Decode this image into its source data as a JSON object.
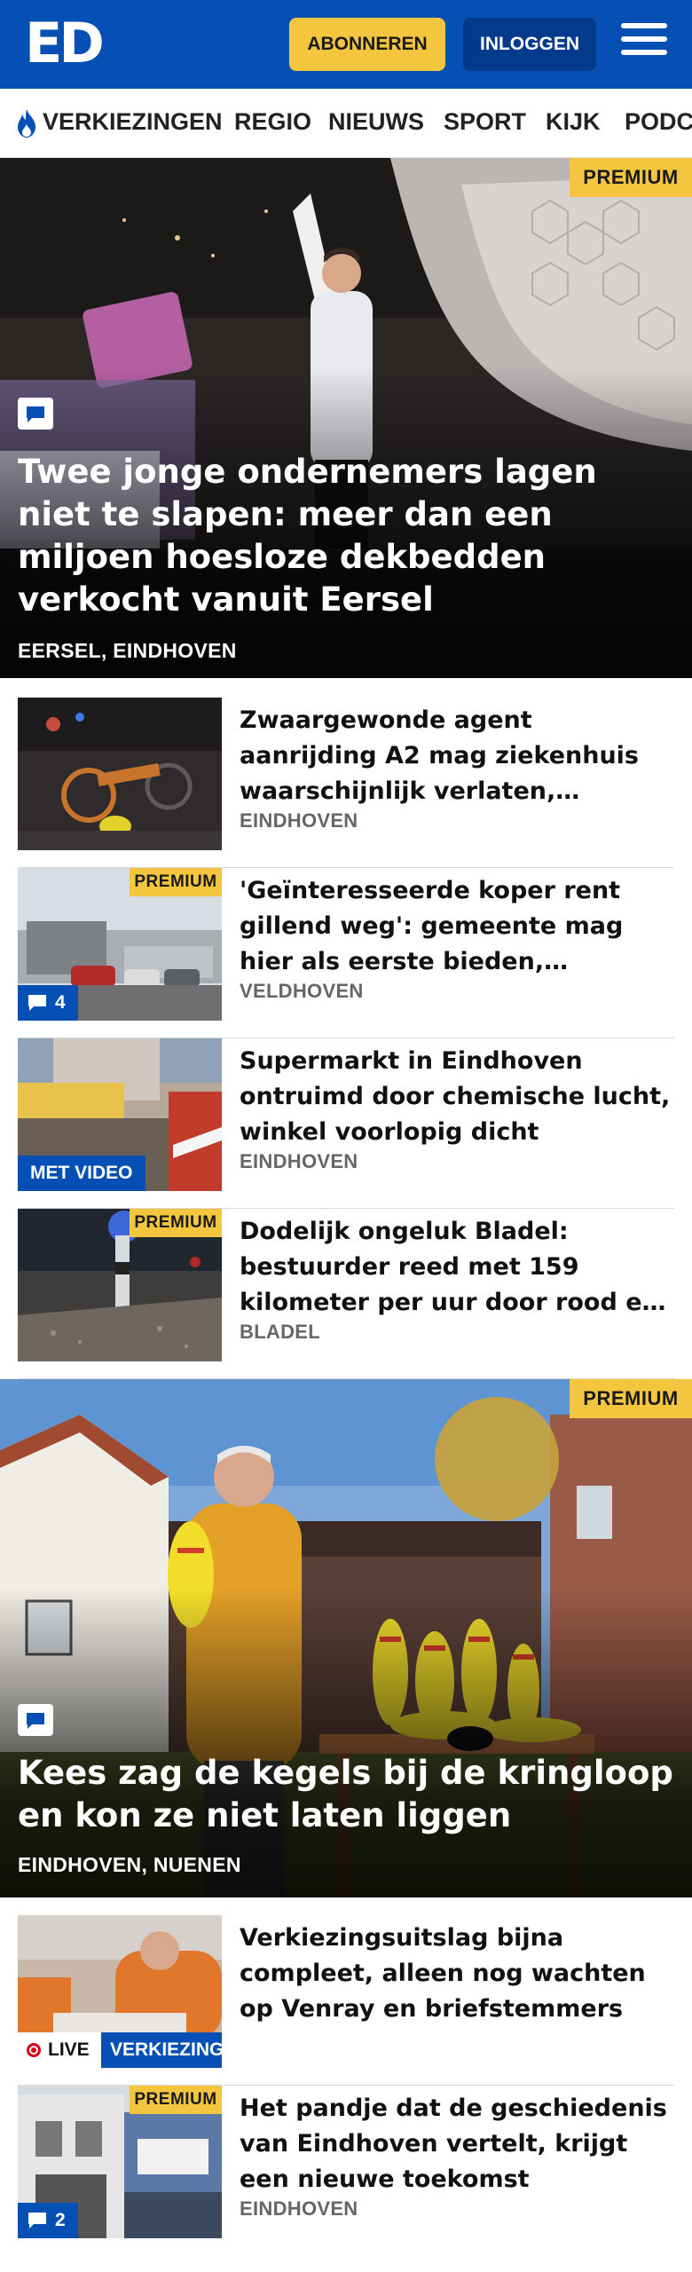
{
  "header": {
    "logo": "ED",
    "subscribe_label": "ABONNEREN",
    "login_label": "INLOGGEN"
  },
  "nav": {
    "items": [
      "VERKIEZINGEN",
      "REGIO",
      "NIEUWS",
      "SPORT",
      "KIJK",
      "PODCAST"
    ]
  },
  "badges": {
    "premium": "PREMIUM",
    "video": "MET VIDEO",
    "live": "LIVE"
  },
  "hero1": {
    "title": "Twee jonge ondernemers lagen niet te slapen: meer dan een miljoen hoesloze dekbedden verkocht vanuit Eersel",
    "location": "EERSEL, EINDHOVEN",
    "premium": true
  },
  "articles": [
    {
      "title": "Zwaargewonde agent aanrijding A2 mag ziekenhuis waarschijnlijk verlaten, operaties blijven nodig",
      "location": "EINDHOVEN"
    },
    {
      "title": "'Geïnteresseerde koper rent gillend weg': gemeente mag hier als eerste bieden, bewoners in onzekerheid",
      "location": "VELDHOVEN",
      "premium": true,
      "comments": "4"
    },
    {
      "title": "Supermarkt in Eindhoven ontruimd door chemische lucht, winkel voorlopig dicht",
      "location": "EINDHOVEN",
      "video": true
    },
    {
      "title": "Dodelijk ongeluk Bladel: bestuurder reed met 159 kilometer per uur door rood en botste",
      "location": "BLADEL",
      "premium": true
    }
  ],
  "hero2": {
    "title": "Kees zag de kegels bij de kringloop en kon ze niet laten liggen",
    "location": "EINDHOVEN, NUENEN",
    "premium": true
  },
  "articles2": [
    {
      "title": "Verkiezingsuitslag bijna compleet, alleen nog wachten op Venray en briefstemmers",
      "location": "",
      "live": true,
      "tag": "VERKIEZINGEN"
    },
    {
      "title": "Het pandje dat de geschiedenis van Eindhoven vertelt, krijgt een nieuwe toekomst",
      "location": "EINDHOVEN",
      "premium": true,
      "comments": "2"
    }
  ],
  "colors": {
    "brand_blue": "#0650b5",
    "premium_yellow": "#f4c53e",
    "dark_blue": "#033a8c"
  },
  "icons": [
    "logo-ed",
    "hamburger-menu-icon",
    "flame-icon",
    "comment-icon",
    "live-dot-icon"
  ]
}
